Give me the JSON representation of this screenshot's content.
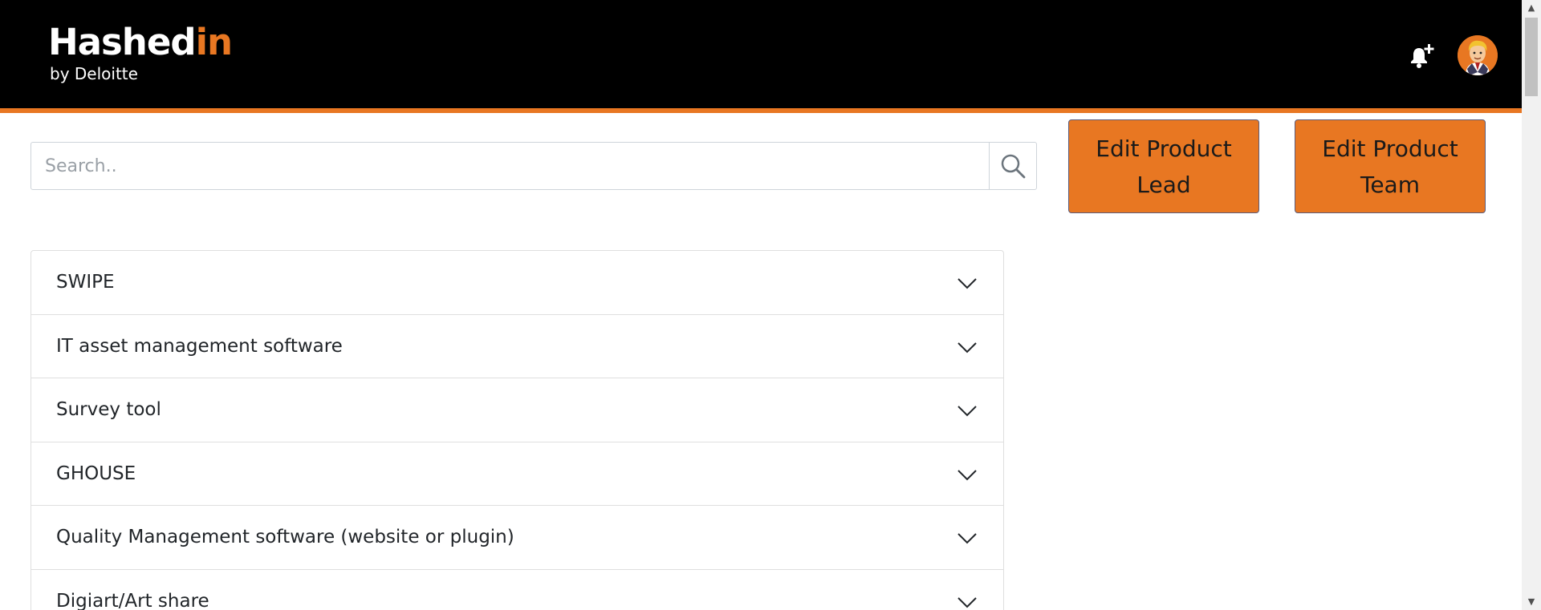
{
  "header": {
    "logo_main": "Hashed",
    "logo_accent": "in",
    "logo_sub": "by Deloitte",
    "brand_color": "#e87722",
    "background": "#000000",
    "bell_icon": "bell-plus-icon",
    "avatar_icon": "user-avatar"
  },
  "search": {
    "placeholder": "Search..",
    "value": "",
    "icon": "search-icon"
  },
  "actions": {
    "edit_lead_label": "Edit Product Lead",
    "edit_team_label": "Edit Product Team"
  },
  "products": [
    {
      "label": "SWIPE"
    },
    {
      "label": "IT asset management software"
    },
    {
      "label": "Survey tool"
    },
    {
      "label": "GHOUSE"
    },
    {
      "label": "Quality Management software (website or plugin)"
    },
    {
      "label": "Digiart/Art share"
    }
  ]
}
